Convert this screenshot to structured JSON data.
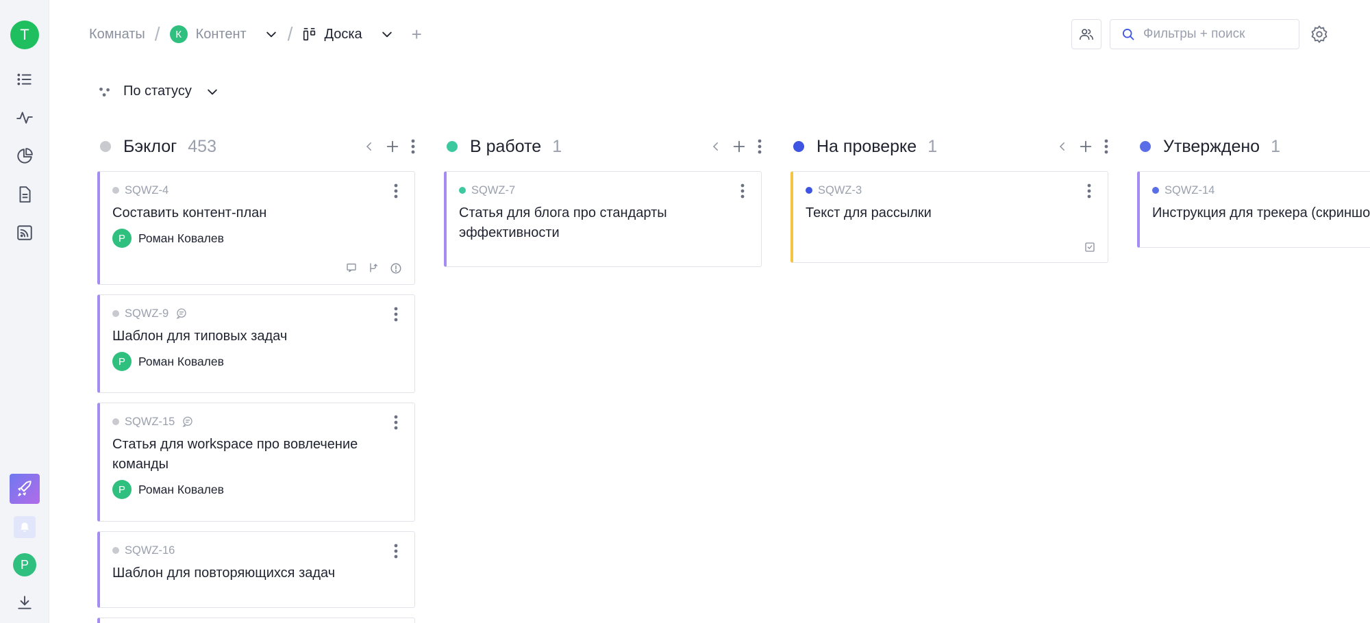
{
  "workspace": {
    "avatar_letter": "Т"
  },
  "user": {
    "avatar_letter": "Р"
  },
  "breadcrumb": {
    "rooms": "Комнаты",
    "project_letter": "К",
    "project": "Контент",
    "view": "Доска"
  },
  "search": {
    "placeholder": "Фильтры + поиск"
  },
  "groupby": {
    "label": "По статусу"
  },
  "columns": [
    {
      "title": "Бэклог",
      "count": "453",
      "color": "#c8cad0",
      "cards": [
        {
          "id": "SQWZ-4",
          "title": "Составить контент-план",
          "assignee": "Роман Ковалев",
          "assignee_letter": "Р"
        },
        {
          "id": "SQWZ-9",
          "title": "Шаблон для типовых задач",
          "assignee": "Роман Ковалев",
          "assignee_letter": "Р"
        },
        {
          "id": "SQWZ-15",
          "title": "Статья для workspace про вовлечение команды",
          "assignee": "Роман Ковалев",
          "assignee_letter": "Р"
        },
        {
          "id": "SQWZ-16",
          "title": "Шаблон для повторяющихся задач"
        }
      ]
    },
    {
      "title": "В работе",
      "count": "1",
      "color": "#3cc9a0",
      "cards": [
        {
          "id": "SQWZ-7",
          "title": "Статья для блога про стандарты эффективности"
        }
      ]
    },
    {
      "title": "На проверке",
      "count": "1",
      "color": "#3d55e0",
      "cards": [
        {
          "id": "SQWZ-3",
          "title": "Текст для рассылки"
        }
      ]
    },
    {
      "title": "Утверждено",
      "count": "1",
      "color": "#5a6ee8",
      "cards": [
        {
          "id": "SQWZ-14",
          "title": "Инструкция для трекера (скриншоты)"
        }
      ]
    }
  ],
  "colors": {
    "accent_purple": "#a58cf2",
    "accent_yellow": "#f5c542",
    "green": "#2fbf7f"
  }
}
